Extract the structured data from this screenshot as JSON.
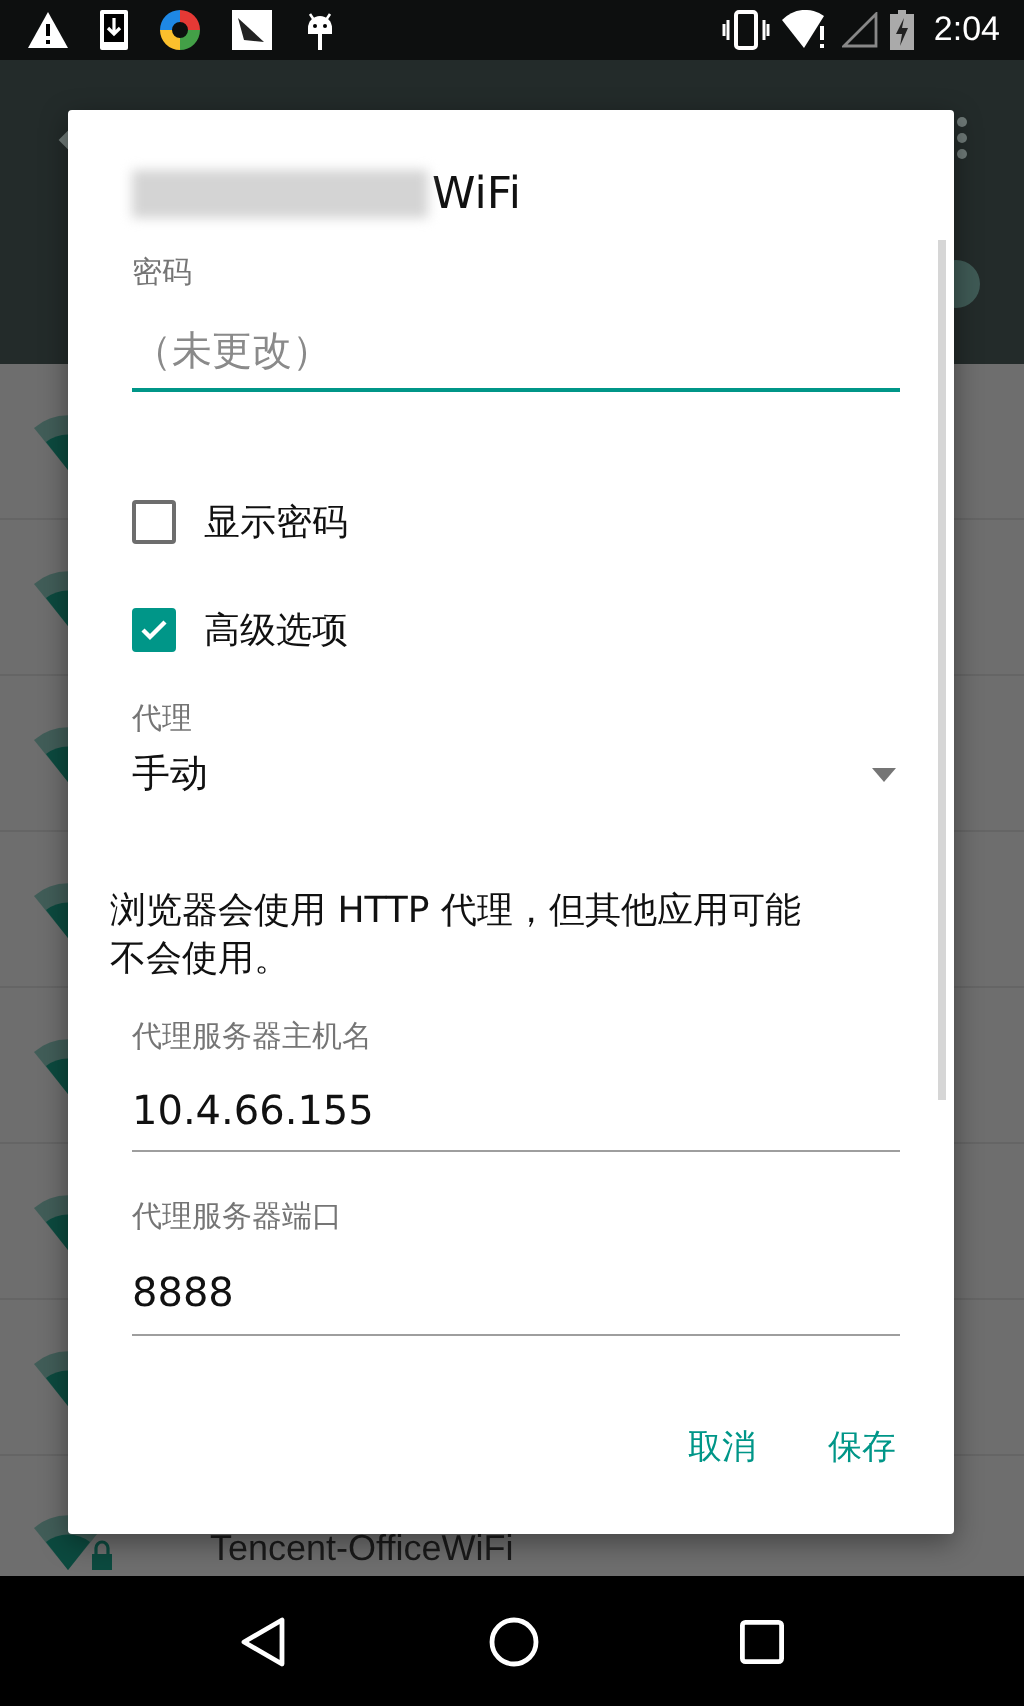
{
  "status_bar": {
    "time": "2:04"
  },
  "background_network": {
    "name": "Tencent-OfficeWiFi",
    "secured": true
  },
  "dialog": {
    "title": "WiFi",
    "title_redacted": true,
    "password": {
      "label": "密码",
      "placeholder": "（未更改）"
    },
    "checkboxes": [
      {
        "label": "显示密码",
        "checked": false
      },
      {
        "label": "高级选项",
        "checked": true
      }
    ],
    "proxy": {
      "label": "代理",
      "value": "手动"
    },
    "proxy_note": "浏览器会使用 HTTP 代理，但其他应用可能不会使用。",
    "fields": [
      {
        "label": "代理服务器主机名",
        "value": "10.4.66.155"
      },
      {
        "label": "代理服务器端口",
        "value": "8888"
      }
    ],
    "buttons": [
      "取消",
      "保存"
    ]
  }
}
